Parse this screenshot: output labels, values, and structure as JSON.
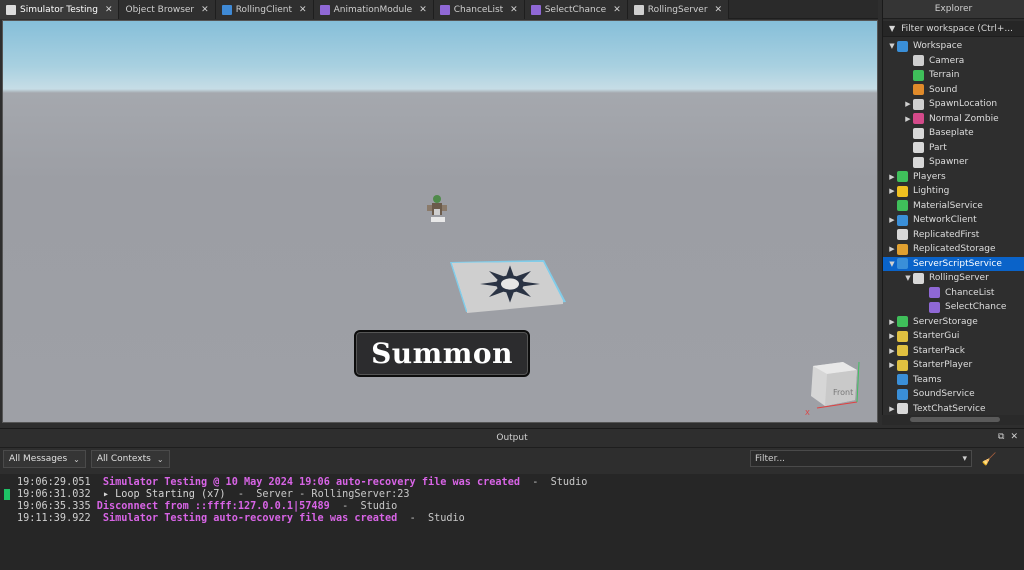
{
  "tabs": [
    {
      "label": "Simulator Testing",
      "icon": "document-icon",
      "active": true
    },
    {
      "label": "Object Browser",
      "icon": "none",
      "active": false
    },
    {
      "label": "RollingClient",
      "icon": "localscript-icon",
      "active": false
    },
    {
      "label": "AnimationModule",
      "icon": "modulescript-icon",
      "active": false
    },
    {
      "label": "ChanceList",
      "icon": "modulescript-icon",
      "active": false
    },
    {
      "label": "SelectChance",
      "icon": "modulescript-icon",
      "active": false
    },
    {
      "label": "RollingServer",
      "icon": "script-icon",
      "active": false
    }
  ],
  "tab_close_glyph": "✕",
  "viewport": {
    "summon_label": "Summon",
    "viewcube_label": "Front",
    "axis_x": "X"
  },
  "explorer": {
    "title": "Explorer",
    "filter_placeholder": "Filter workspace (Ctrl+...",
    "items": [
      {
        "label": "Workspace",
        "depth": 0,
        "arrow": "down",
        "icon_color": "#3a8fd8"
      },
      {
        "label": "Camera",
        "depth": 1,
        "arrow": "",
        "icon_color": "#cfcfcf"
      },
      {
        "label": "Terrain",
        "depth": 1,
        "arrow": "",
        "icon_color": "#3fbf5a"
      },
      {
        "label": "Sound",
        "depth": 1,
        "arrow": "",
        "icon_color": "#e08a2a"
      },
      {
        "label": "SpawnLocation",
        "depth": 1,
        "arrow": "right",
        "icon_color": "#cfcfcf"
      },
      {
        "label": "Normal Zombie",
        "depth": 1,
        "arrow": "right",
        "icon_color": "#d44a8a"
      },
      {
        "label": "Baseplate",
        "depth": 1,
        "arrow": "",
        "icon_color": "#d8d8d8"
      },
      {
        "label": "Part",
        "depth": 1,
        "arrow": "",
        "icon_color": "#d8d8d8"
      },
      {
        "label": "Spawner",
        "depth": 1,
        "arrow": "",
        "icon_color": "#d8d8d8"
      },
      {
        "label": "Players",
        "depth": 0,
        "arrow": "right",
        "icon_color": "#3fbf5a"
      },
      {
        "label": "Lighting",
        "depth": 0,
        "arrow": "right",
        "icon_color": "#f0c020"
      },
      {
        "label": "MaterialService",
        "depth": 0,
        "arrow": "",
        "icon_color": "#3fbf5a"
      },
      {
        "label": "NetworkClient",
        "depth": 0,
        "arrow": "right",
        "icon_color": "#3a8fd8"
      },
      {
        "label": "ReplicatedFirst",
        "depth": 0,
        "arrow": "",
        "icon_color": "#d8d8d8"
      },
      {
        "label": "ReplicatedStorage",
        "depth": 0,
        "arrow": "right",
        "icon_color": "#e0a030"
      },
      {
        "label": "ServerScriptService",
        "depth": 0,
        "arrow": "down",
        "icon_color": "#3a8fd8",
        "selected": true
      },
      {
        "label": "RollingServer",
        "depth": 1,
        "arrow": "down",
        "icon_color": "#d8d8d8"
      },
      {
        "label": "ChanceList",
        "depth": 2,
        "arrow": "",
        "icon_color": "#8f68d6"
      },
      {
        "label": "SelectChance",
        "depth": 2,
        "arrow": "",
        "icon_color": "#8f68d6"
      },
      {
        "label": "ServerStorage",
        "depth": 0,
        "arrow": "right",
        "icon_color": "#3fbf5a"
      },
      {
        "label": "StarterGui",
        "depth": 0,
        "arrow": "right",
        "icon_color": "#e0c040"
      },
      {
        "label": "StarterPack",
        "depth": 0,
        "arrow": "right",
        "icon_color": "#e0c040"
      },
      {
        "label": "StarterPlayer",
        "depth": 0,
        "arrow": "right",
        "icon_color": "#e0c040"
      },
      {
        "label": "Teams",
        "depth": 0,
        "arrow": "",
        "icon_color": "#3a8fd8"
      },
      {
        "label": "SoundService",
        "depth": 0,
        "arrow": "",
        "icon_color": "#3a8fd8"
      },
      {
        "label": "TextChatService",
        "depth": 0,
        "arrow": "right",
        "icon_color": "#d8d8d8"
      }
    ]
  },
  "output": {
    "title": "Output",
    "messages_filter": "All Messages",
    "contexts_filter": "All Contexts",
    "filter_placeholder": "Filter...",
    "logs": [
      {
        "time": "19:06:29.051",
        "message": "Simulator Testing @ 10 May 2024 19:06 auto-recovery file was created",
        "source": "Studio",
        "style": "magenta",
        "marker": false,
        "prefix": "  "
      },
      {
        "time": "19:06:31.032",
        "message": "▸ Loop Starting (x7)",
        "source": "Server - RollingServer:23",
        "style": "plain",
        "marker": true,
        "prefix": "  "
      },
      {
        "time": "19:06:35.335",
        "message": "Disconnect from ::ffff:127.0.0.1|57489",
        "source": "Studio",
        "style": "magenta",
        "marker": false,
        "prefix": " "
      },
      {
        "time": "19:11:39.922",
        "message": "Simulator Testing auto-recovery file was created",
        "source": "Studio",
        "style": "magenta",
        "marker": false,
        "prefix": "  "
      }
    ]
  }
}
